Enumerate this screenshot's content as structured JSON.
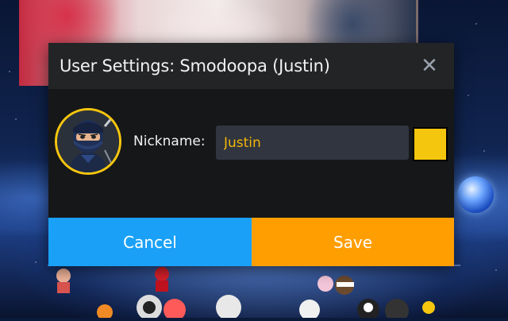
{
  "modal": {
    "title": "User Settings: Smodoopa (Justin)",
    "close_symbol": "✕",
    "nickname_label": "Nickname:",
    "nickname_value": "Justin",
    "nickname_color": "#f5c60e",
    "avatar_icon": "ninja-avatar-icon",
    "cancel_label": "Cancel",
    "save_label": "Save"
  },
  "colors": {
    "cancel_button": "#1aa1f7",
    "save_button": "#ff9e00",
    "accent_yellow": "#f5c60e"
  }
}
